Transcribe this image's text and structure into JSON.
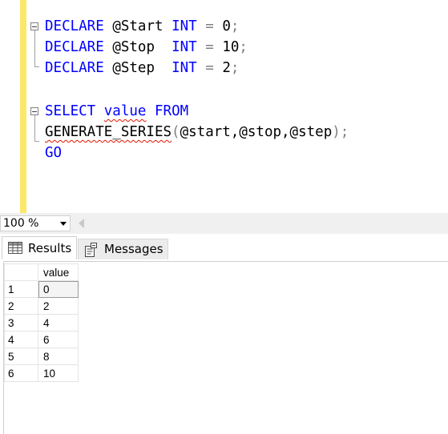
{
  "editor": {
    "lines": [
      {
        "kw1": "DECLARE",
        "var": "@Start",
        "type": "INT",
        "op": "=",
        "val": "0",
        "end": ";"
      },
      {
        "kw1": "DECLARE",
        "var": "@Stop",
        "type": "INT",
        "op": "=",
        "val": "10",
        "end": ";"
      },
      {
        "kw1": "DECLARE",
        "var": "@Step",
        "type": "INT",
        "op": "=",
        "val": "2",
        "end": ";"
      }
    ],
    "select_line": {
      "kw_select": "SELECT",
      "field": "value",
      "kw_from": "FROM"
    },
    "series_line": {
      "func": "GENERATE_SERIES",
      "open": "(",
      "args": "@start,@stop,@step",
      "close": ")",
      "end": ";"
    },
    "go_line": "GO"
  },
  "zoom": {
    "value": "100 %"
  },
  "tabs": {
    "results": "Results",
    "messages": "Messages"
  },
  "grid": {
    "column": "value",
    "rows": [
      {
        "n": "1",
        "v": "0"
      },
      {
        "n": "2",
        "v": "2"
      },
      {
        "n": "3",
        "v": "4"
      },
      {
        "n": "4",
        "v": "6"
      },
      {
        "n": "5",
        "v": "8"
      },
      {
        "n": "6",
        "v": "10"
      }
    ]
  },
  "colors": {
    "keyword": "#0000ff",
    "operator": "#808080",
    "function": "#ff00ff",
    "gutter": "#fbe86a",
    "squiggle": "#e51400"
  }
}
